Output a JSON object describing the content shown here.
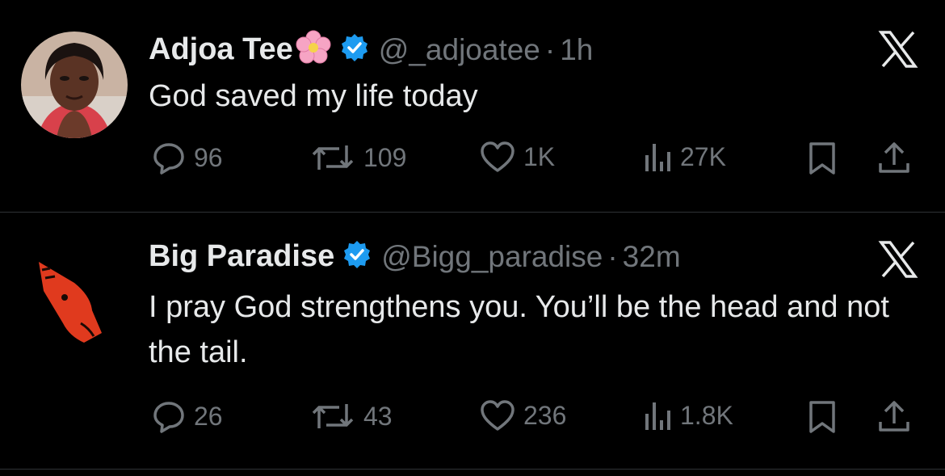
{
  "tweets": [
    {
      "author": "Adjoa Tee",
      "handle": "@_adjoatee",
      "separator": "·",
      "time": "1h",
      "text": "God saved my life today",
      "stats": {
        "replies": "96",
        "reposts": "109",
        "likes": "1K",
        "views": "27K"
      }
    },
    {
      "author": "Big Paradise",
      "handle": "@Bigg_paradise",
      "separator": "·",
      "time": "32m",
      "text": "I pray God strengthens you. You’ll be the head and not the tail.",
      "stats": {
        "replies": "26",
        "reposts": "43",
        "likes": "236",
        "views": "1.8K"
      }
    }
  ],
  "icons": [
    "flower-emoji-icon",
    "verified-badge-icon",
    "x-logo-icon",
    "reply-icon",
    "repost-icon",
    "like-icon",
    "views-icon",
    "bookmark-icon",
    "share-icon"
  ],
  "colors": {
    "background": "#000000",
    "text": "#e7e9ea",
    "muted": "#71767b",
    "verified": "#1d9bf0",
    "divider": "#2f3336"
  }
}
